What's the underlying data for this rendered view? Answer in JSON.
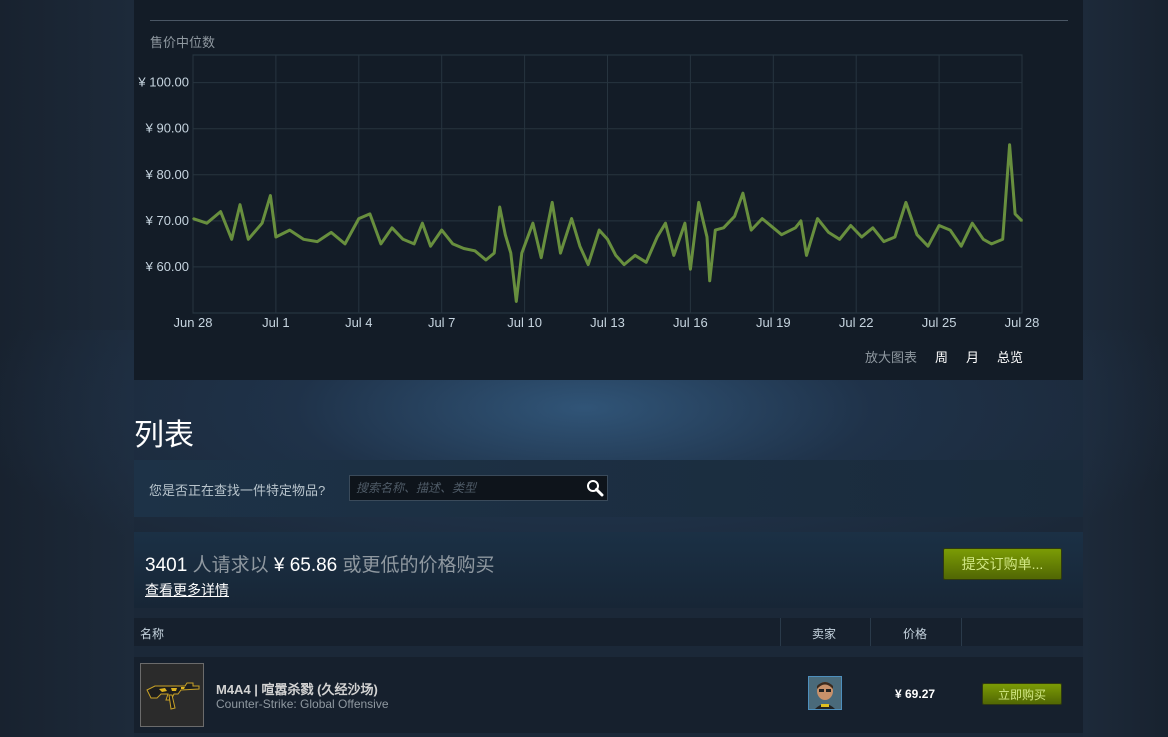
{
  "chart_panel": {
    "title": "售价中位数",
    "zoom_label": "放大图表",
    "zoom_options": [
      "周",
      "月",
      "总览"
    ]
  },
  "chart_data": {
    "type": "line",
    "title": "售价中位数",
    "y_tick_labels": [
      "¥ 100.00",
      "¥ 90.00",
      "¥ 80.00",
      "¥ 70.00",
      "¥ 60.00"
    ],
    "y_ticks": [
      100,
      90,
      80,
      70,
      60
    ],
    "ylim": [
      50,
      106
    ],
    "x_tick_labels": [
      "Jun 28",
      "Jul 1",
      "Jul 4",
      "Jul 7",
      "Jul 10",
      "Jul 13",
      "Jul 16",
      "Jul 19",
      "Jul 22",
      "Jul 25",
      "Jul 28"
    ],
    "x_ticks": [
      0,
      3,
      6,
      9,
      12,
      15,
      18,
      21,
      24,
      27,
      30
    ],
    "xlim": [
      0,
      30
    ],
    "grid": true,
    "series_color": "#688f3e",
    "series": [
      {
        "values": [
          [
            0.0,
            70.5
          ],
          [
            0.5,
            69.5
          ],
          [
            1.0,
            72.0
          ],
          [
            1.4,
            66.0
          ],
          [
            1.7,
            73.5
          ],
          [
            2.0,
            66.0
          ],
          [
            2.5,
            69.5
          ],
          [
            2.8,
            75.5
          ],
          [
            3.0,
            66.5
          ],
          [
            3.5,
            68.0
          ],
          [
            4.0,
            66.0
          ],
          [
            4.5,
            65.5
          ],
          [
            5.0,
            67.5
          ],
          [
            5.5,
            65.0
          ],
          [
            6.0,
            70.5
          ],
          [
            6.4,
            71.5
          ],
          [
            6.8,
            65.0
          ],
          [
            7.2,
            68.5
          ],
          [
            7.6,
            66.0
          ],
          [
            8.0,
            65.0
          ],
          [
            8.3,
            69.5
          ],
          [
            8.6,
            64.5
          ],
          [
            9.0,
            68.0
          ],
          [
            9.4,
            65.0
          ],
          [
            9.8,
            64.0
          ],
          [
            10.2,
            63.5
          ],
          [
            10.6,
            61.5
          ],
          [
            10.9,
            63.0
          ],
          [
            11.1,
            73.0
          ],
          [
            11.3,
            67.0
          ],
          [
            11.5,
            63.0
          ],
          [
            11.7,
            52.5
          ],
          [
            11.9,
            63.0
          ],
          [
            12.3,
            69.5
          ],
          [
            12.6,
            62.0
          ],
          [
            13.0,
            74.0
          ],
          [
            13.3,
            63.0
          ],
          [
            13.7,
            70.5
          ],
          [
            14.0,
            64.5
          ],
          [
            14.3,
            60.5
          ],
          [
            14.7,
            68.0
          ],
          [
            15.0,
            66.0
          ],
          [
            15.3,
            62.5
          ],
          [
            15.6,
            60.5
          ],
          [
            16.0,
            62.5
          ],
          [
            16.4,
            61.0
          ],
          [
            16.8,
            66.5
          ],
          [
            17.1,
            69.5
          ],
          [
            17.4,
            62.5
          ],
          [
            17.8,
            69.5
          ],
          [
            18.0,
            59.5
          ],
          [
            18.3,
            74.0
          ],
          [
            18.6,
            66.5
          ],
          [
            18.7,
            57.0
          ],
          [
            18.9,
            68.0
          ],
          [
            19.2,
            68.5
          ],
          [
            19.6,
            71.0
          ],
          [
            19.9,
            76.0
          ],
          [
            20.2,
            68.0
          ],
          [
            20.6,
            70.5
          ],
          [
            21.0,
            68.5
          ],
          [
            21.3,
            67.0
          ],
          [
            21.8,
            68.5
          ],
          [
            22.0,
            70.0
          ],
          [
            22.2,
            62.5
          ],
          [
            22.6,
            70.5
          ],
          [
            23.0,
            67.5
          ],
          [
            23.4,
            66.0
          ],
          [
            23.8,
            69.0
          ],
          [
            24.2,
            66.5
          ],
          [
            24.6,
            68.5
          ],
          [
            25.0,
            65.5
          ],
          [
            25.4,
            66.5
          ],
          [
            25.8,
            74.0
          ],
          [
            26.2,
            67.0
          ],
          [
            26.6,
            64.5
          ],
          [
            27.0,
            69.0
          ],
          [
            27.4,
            68.0
          ],
          [
            27.8,
            64.5
          ],
          [
            28.2,
            69.5
          ],
          [
            28.6,
            66.0
          ],
          [
            28.9,
            65.0
          ],
          [
            29.3,
            66.0
          ],
          [
            29.55,
            86.5
          ],
          [
            29.75,
            71.5
          ],
          [
            30.0,
            70.0
          ]
        ]
      }
    ]
  },
  "section_title": "列表",
  "search": {
    "label": "您是否正在查找一件特定物品?",
    "placeholder": "搜索名称、描述、类型"
  },
  "buy_order": {
    "count": "3401",
    "text_a": "人请求以",
    "price": "¥ 65.86",
    "text_b": "或更低的价格购买",
    "details_link": "查看更多详情",
    "button_label": "提交订购单..."
  },
  "table": {
    "headers": {
      "name": "名称",
      "seller": "卖家",
      "price": "价格"
    }
  },
  "listings": [
    {
      "name": "M4A4 | 喧嚣杀戮 (久经沙场)",
      "game": "Counter-Strike: Global Offensive",
      "price": "¥ 69.27",
      "buy_label": "立即购买"
    }
  ]
}
